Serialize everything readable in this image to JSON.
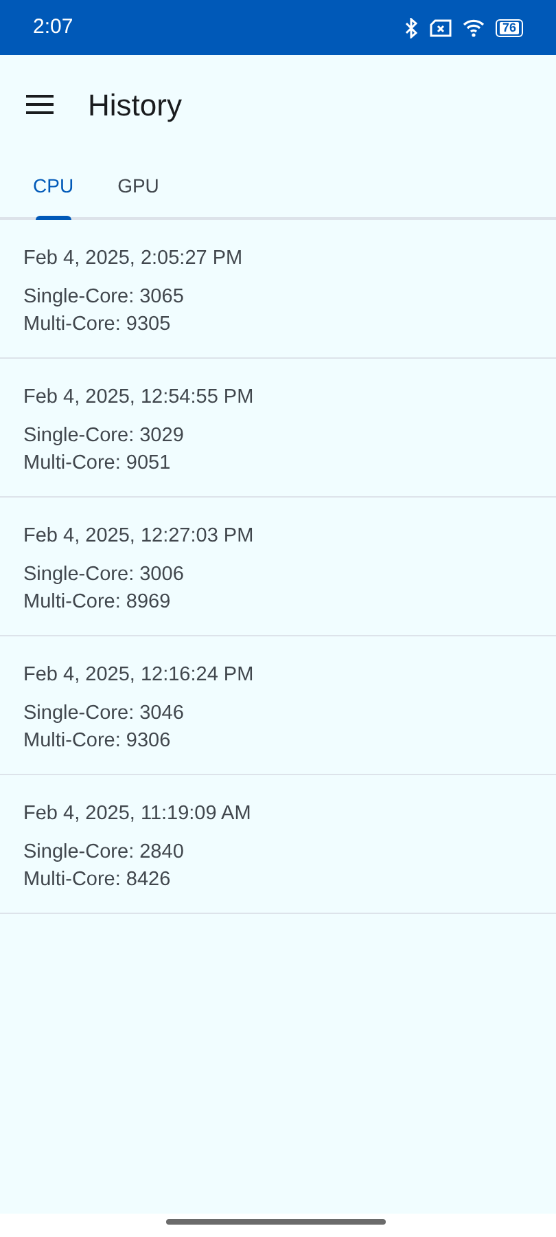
{
  "status_bar": {
    "time": "2:07",
    "battery": "76"
  },
  "app_bar": {
    "title": "History"
  },
  "tabs": [
    {
      "label": "CPU",
      "selected": true
    },
    {
      "label": "GPU",
      "selected": false
    }
  ],
  "entries": [
    {
      "date": "Feb 4, 2025, 2:05:27 PM",
      "single_core": "Single-Core: 3065",
      "multi_core": "Multi-Core: 9305"
    },
    {
      "date": "Feb 4, 2025, 12:54:55 PM",
      "single_core": "Single-Core: 3029",
      "multi_core": "Multi-Core: 9051"
    },
    {
      "date": "Feb 4, 2025, 12:27:03 PM",
      "single_core": "Single-Core: 3006",
      "multi_core": "Multi-Core: 8969"
    },
    {
      "date": "Feb 4, 2025, 12:16:24 PM",
      "single_core": "Single-Core: 3046",
      "multi_core": "Multi-Core: 9306"
    },
    {
      "date": "Feb 4, 2025, 11:19:09 AM",
      "single_core": "Single-Core: 2840",
      "multi_core": "Multi-Core: 8426"
    }
  ]
}
